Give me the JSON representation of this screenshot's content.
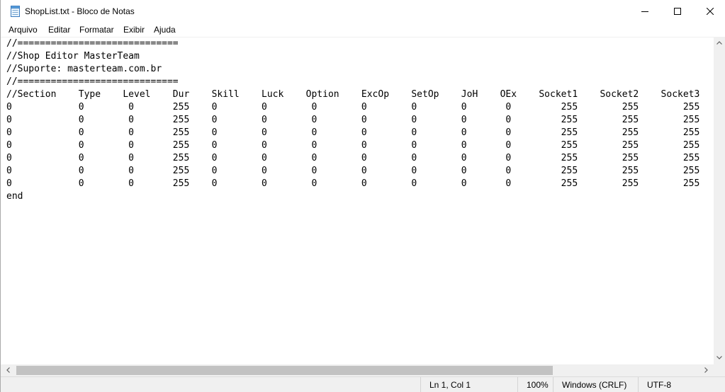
{
  "window": {
    "title": "ShopList.txt - Bloco de Notas"
  },
  "menu": {
    "items": [
      "Arquivo",
      "Editar",
      "Formatar",
      "Exibir",
      "Ajuda"
    ]
  },
  "editor": {
    "lines": [
      "//=============================",
      "//Shop Editor MasterTeam",
      "//Suporte: masterteam.com.br",
      "//=============================",
      "//Section    Type    Level    Dur    Skill    Luck    Option    ExcOp    SetOp    JoH    OEx    Socket1    Socket2    Socket3",
      "0            0        0       255    0        0        0        0        0        0       0         255        255        255",
      "0            0        0       255    0        0        0        0        0        0       0         255        255        255",
      "0            0        0       255    0        0        0        0        0        0       0         255        255        255",
      "0            0        0       255    0        0        0        0        0        0       0         255        255        255",
      "0            0        0       255    0        0        0        0        0        0       0         255        255        255",
      "0            0        0       255    0        0        0        0        0        0       0         255        255        255",
      "0            0        0       255    0        0        0        0        0        0       0         255        255        255",
      "end"
    ]
  },
  "statusbar": {
    "position": "Ln 1, Col 1",
    "zoom": "100%",
    "line_ending": "Windows (CRLF)",
    "encoding": "UTF-8"
  },
  "icons": {
    "app": "notepad-icon",
    "minimize": "minimize-icon",
    "maximize": "maximize-icon",
    "close": "close-icon"
  },
  "colors": {
    "background": "#ffffff",
    "chrome": "#f0f0f0",
    "scroll_thumb": "#c2c2c2"
  }
}
